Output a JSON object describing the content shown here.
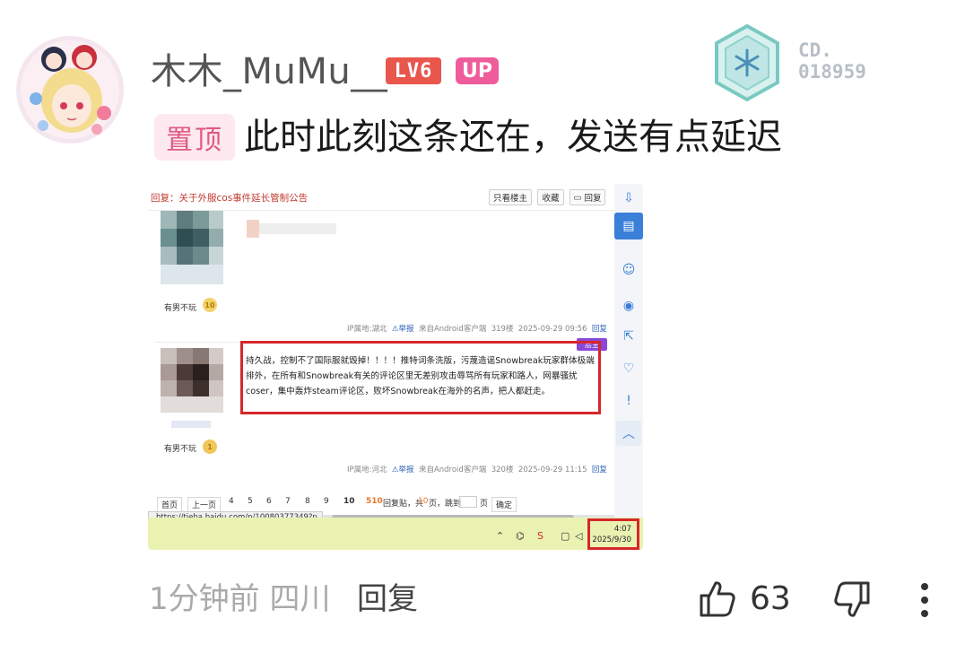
{
  "comment": {
    "username": "木木_MuMu__",
    "level_badge": "LV6",
    "up_badge": "UP",
    "medal_code": "CD.\n018959",
    "pin_tag": "置顶",
    "text": "此时此刻这条还在，发送有点延迟",
    "time": "1分钟前",
    "location": "四川",
    "reply_label": "回复",
    "like_count": "63"
  },
  "screenshot": {
    "title": "回复：关于外服cos事件延长管制公告",
    "header_buttons": [
      "只看楼主",
      "收藏",
      "回复"
    ],
    "posts": [
      {
        "user_label": "有男不玩",
        "level": "10",
        "ip": "IP属地:湖北",
        "report": "举报",
        "client": "来自Android客户端",
        "floor": "319楼",
        "datetime": "2025-09-29 09:56",
        "reply": "回复"
      },
      {
        "user_label": "有男不玩",
        "level": "1",
        "content": "持久战，控制不了国际服就毁掉！！！！推特词条洗版，污蔑造谣Snowbreak玩家群体极端排外，在所有和Snowbreak有关的评论区里无差别攻击辱骂所有玩家和路人，网暴骚扰coser，集中轰炸steam评论区，败坏Snowbreak在海外的名声，把人都赶走。",
        "tag": "层主",
        "ip": "IP属地:河北",
        "report": "举报",
        "client": "来自Android客户端",
        "floor": "320楼",
        "datetime": "2025-09-29 11:15",
        "reply": "回复"
      }
    ],
    "pager": {
      "first": "首页",
      "prev": "上一页",
      "pages": [
        "4",
        "5",
        "6",
        "7",
        "8",
        "9",
        "10"
      ],
      "summary_count": "510",
      "summary_text": "回复贴，共",
      "total_pages": "10",
      "pages_suffix": "页，跳到",
      "page_unit": "页",
      "confirm": "确定"
    },
    "status_url": "https://tieba.baidu.com/p/10080377349?p...",
    "clock_time": "4:07",
    "clock_date": "2025/9/30"
  },
  "colors": {
    "accent_red": "#d6272c",
    "level_badge": "#e8564c",
    "up_badge": "#ee5c9b",
    "pin_bg": "#fde9ef",
    "taskbar": "#eaf2b2"
  },
  "icons": [
    "avatar-image",
    "hex-medal-icon",
    "thumbs-up-icon",
    "thumbs-down-icon",
    "more-vertical-icon"
  ]
}
